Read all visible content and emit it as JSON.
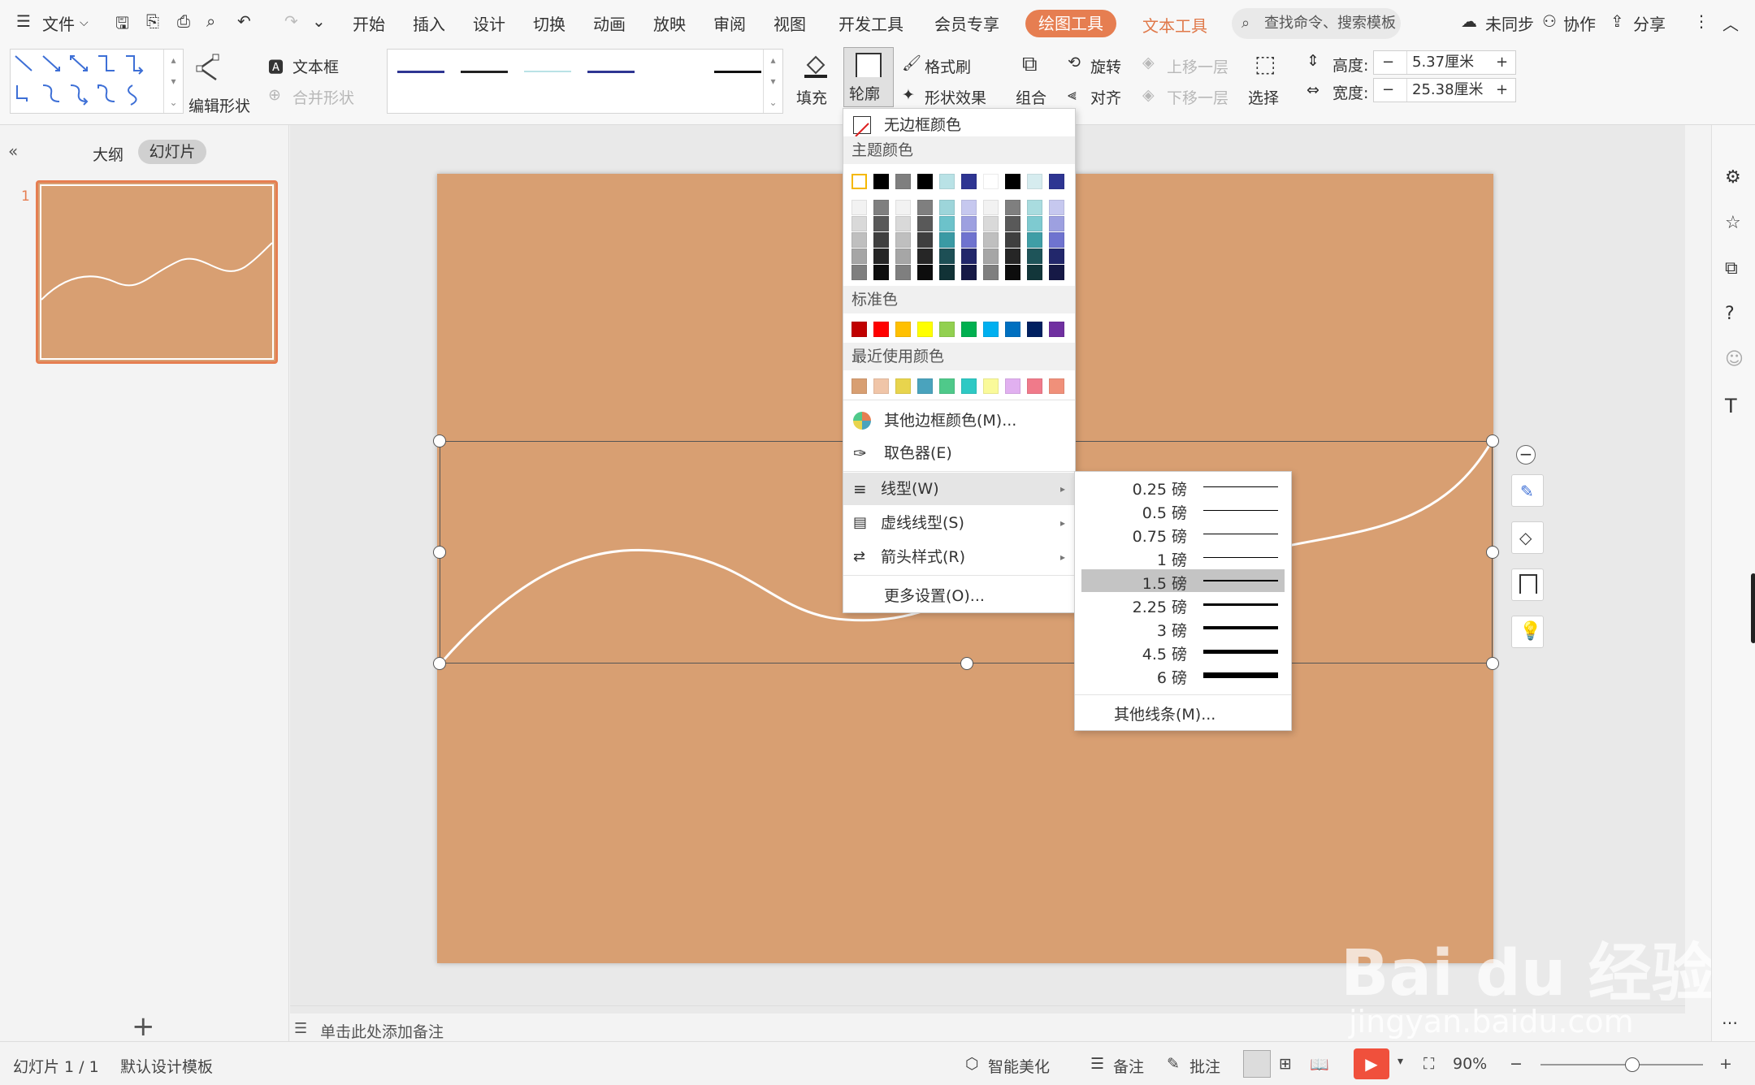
{
  "menubar": {
    "file": "文件",
    "tabs": [
      "开始",
      "插入",
      "设计",
      "切换",
      "动画",
      "放映",
      "审阅",
      "视图",
      "开发工具",
      "会员专享"
    ],
    "active_tab": "绘图工具",
    "text_tools_tab": "文本工具",
    "search_placeholder": "查找命令、搜索模板",
    "sync": "未同步",
    "collab": "协作",
    "share": "分享"
  },
  "ribbon": {
    "edit_shape": "编辑形状",
    "textbox": "文本框",
    "merge_shape": "合并形状",
    "fill": "填充",
    "outline": "轮廓",
    "format_painter": "格式刷",
    "shape_effects": "形状效果",
    "group": "组合",
    "rotate": "旋转",
    "align": "对齐",
    "bring_forward": "上移一层",
    "send_backward": "下移一层",
    "select": "选择",
    "height_label": "高度:",
    "height_value": "5.37厘米",
    "width_label": "宽度:",
    "width_value": "25.38厘米",
    "minus": "−",
    "plus": "+"
  },
  "leftpanel": {
    "outline_tab": "大纲",
    "slides_tab": "幻灯片",
    "slide_number": "1",
    "add_slide": "+"
  },
  "notes": {
    "placeholder": "单击此处添加备注"
  },
  "dropdown": {
    "no_border": "无边框颜色",
    "theme_colors": "主题颜色",
    "standard_colors": "标准色",
    "recent_colors": "最近使用颜色",
    "more_colors": "其他边框颜色(M)...",
    "eyedropper": "取色器(E)",
    "line_style": "线型(W)",
    "dash_style": "虚线线型(S)",
    "arrow_style": "箭头样式(R)",
    "more_settings": "更多设置(O)...",
    "theme_top_row": [
      "#ffffff",
      "#000000",
      "#7f7f7f",
      "#000000",
      "#b9e2e6",
      "#2e3592",
      "#ffffff",
      "#000000",
      "#d6ecef",
      "#2e3592"
    ],
    "theme_shades": [
      [
        "#f2f2f2",
        "#7f7f7f",
        "#f2f2f2",
        "#7f7f7f",
        "#9dd5da",
        "#c6c8ef",
        "#f2f2f2",
        "#7f7f7f",
        "#a9dcdf",
        "#c6c8ef"
      ],
      [
        "#d9d9d9",
        "#595959",
        "#d9d9d9",
        "#595959",
        "#6cc2ca",
        "#9da0e0",
        "#d9d9d9",
        "#595959",
        "#7ecad0",
        "#9da0e0"
      ],
      [
        "#bfbfbf",
        "#3f3f3f",
        "#bfbfbf",
        "#3f3f3f",
        "#3a9aa4",
        "#6f73cf",
        "#bfbfbf",
        "#3f3f3f",
        "#3f9ea6",
        "#6f73cf"
      ],
      [
        "#a6a6a6",
        "#262626",
        "#a6a6a6",
        "#262626",
        "#1d4f55",
        "#22276b",
        "#a6a6a6",
        "#262626",
        "#1e5459",
        "#22276b"
      ],
      [
        "#7f7f7f",
        "#0d0d0d",
        "#7f7f7f",
        "#0d0d0d",
        "#113236",
        "#161946",
        "#7f7f7f",
        "#0d0d0d",
        "#12363a",
        "#161946"
      ]
    ],
    "standard": [
      "#c00000",
      "#ff0000",
      "#ffc000",
      "#ffff00",
      "#92d050",
      "#00b050",
      "#00b0f0",
      "#0070c0",
      "#002060",
      "#7030a0"
    ],
    "recent": [
      "#d89f72",
      "#f0c5a8",
      "#e8d44d",
      "#4aa3bd",
      "#4fc98a",
      "#2ec9c4",
      "#fafa9a",
      "#e1b0f0",
      "#f07a8a",
      "#f0907a"
    ]
  },
  "submenu": {
    "weights": [
      {
        "label": "0.25 磅",
        "pt": 0.25
      },
      {
        "label": "0.5 磅",
        "pt": 0.5
      },
      {
        "label": "0.75 磅",
        "pt": 0.75
      },
      {
        "label": "1 磅",
        "pt": 1
      },
      {
        "label": "1.5 磅",
        "pt": 1.5
      },
      {
        "label": "2.25 磅",
        "pt": 2.25
      },
      {
        "label": "3 磅",
        "pt": 3
      },
      {
        "label": "4.5 磅",
        "pt": 4.5
      },
      {
        "label": "6 磅",
        "pt": 6
      }
    ],
    "selected_label": "1.5 磅",
    "more_lines": "其他线条(M)..."
  },
  "statusbar": {
    "slide_count": "幻灯片 1 / 1",
    "template": "默认设计模板",
    "beautify": "智能美化",
    "notes": "备注",
    "comments": "批注",
    "zoom": "90%",
    "zoom_level": 0.9
  },
  "watermark": {
    "brand": "Bai du 经验",
    "url": "jingyan.baidu.com"
  },
  "colors": {
    "slide_bg": "#d89f72",
    "accent": "#e67e51",
    "play": "#f0503c"
  }
}
